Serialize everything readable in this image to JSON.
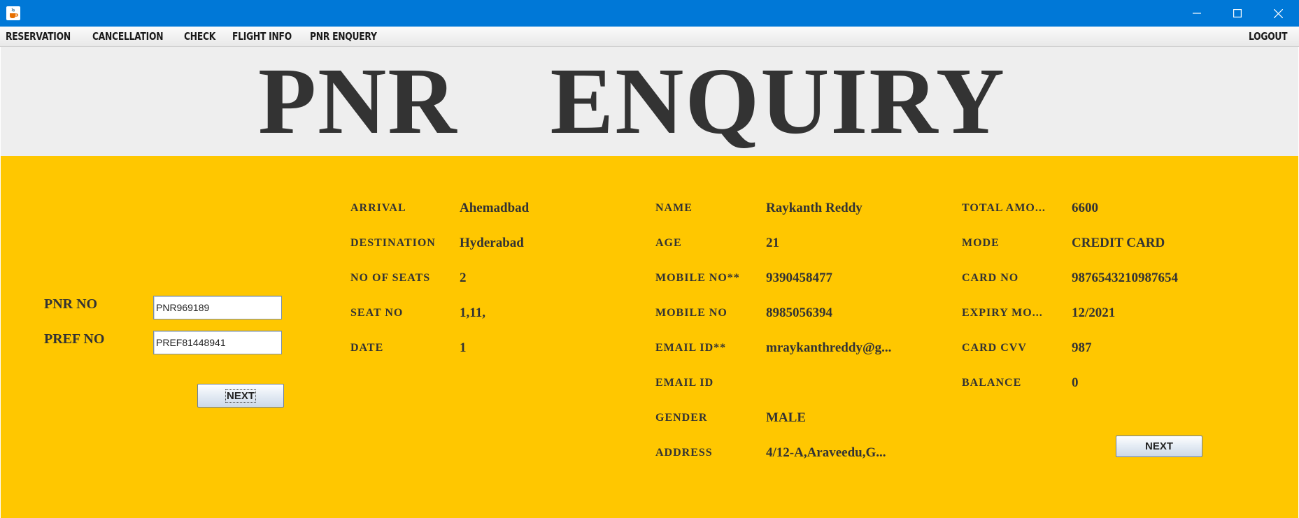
{
  "window": {
    "icon": "java-cup-icon",
    "controls": [
      "minimize-icon",
      "maximize-icon",
      "close-icon"
    ],
    "titlebar_color": "#0078d7"
  },
  "menu": {
    "items": [
      "RESERVATION",
      "CANCELLATION",
      "CHECK",
      "FLIGHT INFO",
      "PNR ENQUERY"
    ],
    "logout": "LOGOUT"
  },
  "header": {
    "title": "PNR  ENQUIRY"
  },
  "form": {
    "pnr_label": "PNR NO",
    "pnr_value": "PNR969189",
    "pref_label": "PREF NO",
    "pref_value": "PREF81448941",
    "next_label": "NEXT"
  },
  "flight": {
    "arrival_label": "ARRIVAL",
    "arrival_value": "Ahemadbad",
    "destination_label": "DESTINATION",
    "destination_value": "Hyderabad",
    "seats_label": "NO OF SEATS",
    "seats_value": "2",
    "seat_no_label": "SEAT NO",
    "seat_no_value": "1,11,",
    "date_label": "DATE",
    "date_value": "1"
  },
  "passenger": {
    "name_label": "NAME",
    "name_value": "Raykanth Reddy",
    "age_label": "AGE",
    "age_value": "21",
    "mobile1_label": "MOBILE NO**",
    "mobile1_value": "9390458477",
    "mobile2_label": "MOBILE NO",
    "mobile2_value": "8985056394",
    "email1_label": "EMAIL ID**",
    "email1_value": "mraykanthreddy@g...",
    "email2_label": "EMAIL ID",
    "email2_value": "",
    "gender_label": "GENDER",
    "gender_value": "MALE",
    "address_label": "ADDRESS",
    "address_value": "4/12-A,Araveedu,G..."
  },
  "payment": {
    "total_label": "TOTAL AMO...",
    "total_value": "6600",
    "mode_label": "MODE",
    "mode_value": "CREDIT CARD",
    "card_label": "CARD NO",
    "card_value": "9876543210987654",
    "expiry_label": "EXPIRY MO...",
    "expiry_value": "12/2021",
    "cvv_label": "CARD CVV",
    "cvv_value": "987",
    "balance_label": "BALANCE",
    "balance_value": "0",
    "next_label": "NEXT"
  },
  "colors": {
    "panel": "#ffc700",
    "header_bg": "#eeeeee",
    "text": "#333333"
  }
}
